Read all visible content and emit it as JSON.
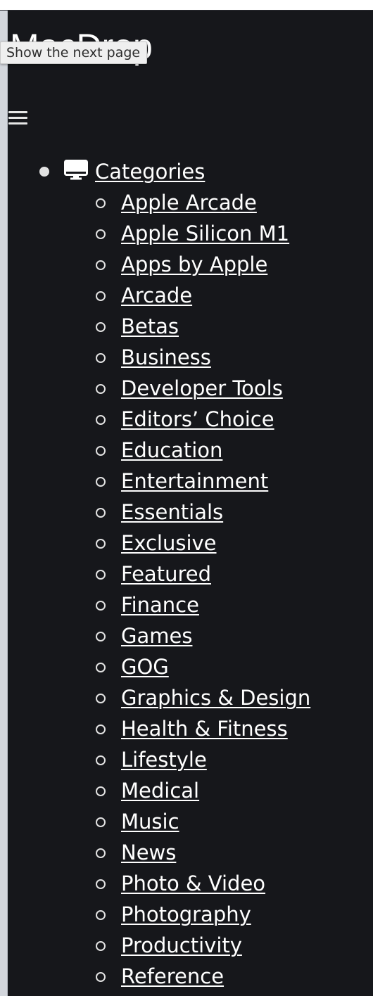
{
  "header": {
    "logo_text": "MacDrop",
    "tooltip": "Show the next page"
  },
  "nav": {
    "menu_icon": "hamburger-menu-icon",
    "categories_icon": "desktop-monitor-icon",
    "categories_label": "Categories",
    "items": [
      {
        "label": "Apple Arcade"
      },
      {
        "label": "Apple Silicon M1"
      },
      {
        "label": "Apps by Apple"
      },
      {
        "label": "Arcade"
      },
      {
        "label": "Betas"
      },
      {
        "label": "Business"
      },
      {
        "label": "Developer Tools"
      },
      {
        "label": "Editors’ Choice"
      },
      {
        "label": "Education"
      },
      {
        "label": "Entertainment"
      },
      {
        "label": "Essentials"
      },
      {
        "label": "Exclusive"
      },
      {
        "label": "Featured"
      },
      {
        "label": "Finance"
      },
      {
        "label": "Games"
      },
      {
        "label": "GOG"
      },
      {
        "label": "Graphics & Design"
      },
      {
        "label": "Health & Fitness"
      },
      {
        "label": "Lifestyle"
      },
      {
        "label": "Medical"
      },
      {
        "label": "Music"
      },
      {
        "label": "News"
      },
      {
        "label": "Photo & Video"
      },
      {
        "label": "Photography"
      },
      {
        "label": "Productivity"
      },
      {
        "label": "Reference"
      }
    ]
  },
  "colors": {
    "background": "#16171b",
    "text": "#ffffff",
    "tooltip_bg": "#efefef"
  }
}
